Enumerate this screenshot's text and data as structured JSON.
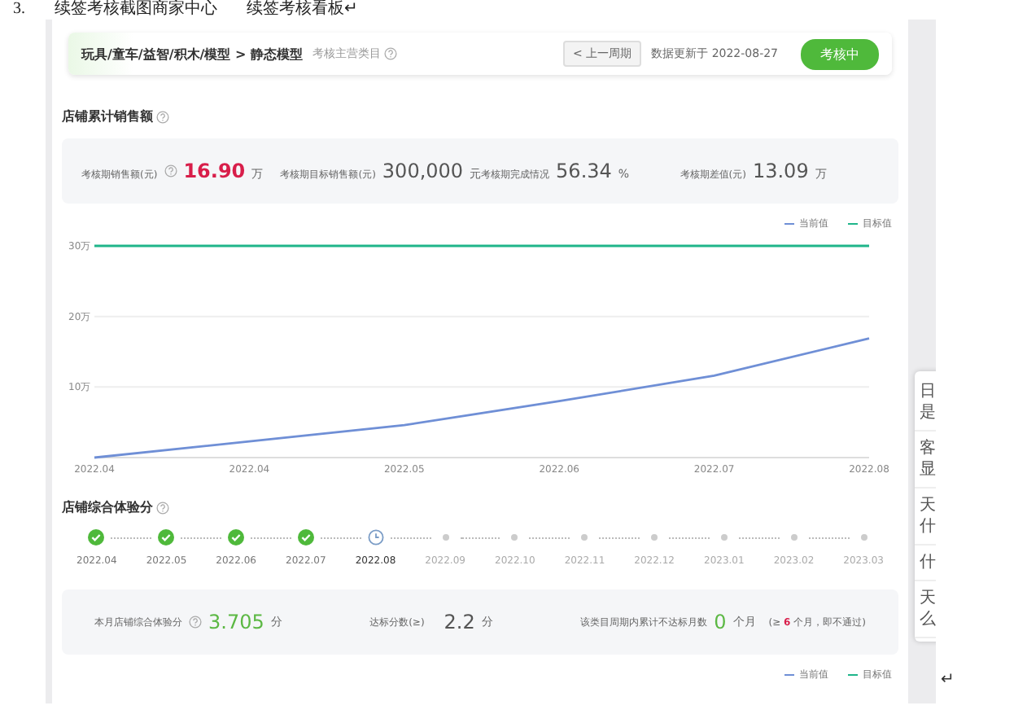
{
  "document": {
    "heading": [
      "3.",
      "续签考核截图商家中心",
      "续签考核看板↵"
    ],
    "end_mark": "↵"
  },
  "header": {
    "category_path": "玩具/童车/益智/积木/模型 > 静态模型",
    "category_hint": "考核主营类目",
    "prev_button": "< 上一周期",
    "updated": "数据更新于 2022-08-27",
    "status": "考核中"
  },
  "sales": {
    "title": "店铺累计销售额",
    "stats": [
      {
        "label": "考核期销售额(元)",
        "help": true,
        "value": "16.90",
        "unit": "万",
        "highlighted": true
      },
      {
        "label": "考核期目标销售额(元)",
        "help": false,
        "value": "300,000",
        "unit": "元",
        "highlighted": false
      },
      {
        "label": "考核期完成情况",
        "help": false,
        "value": "56.34",
        "unit": "%",
        "highlighted": false
      },
      {
        "label": "考核期差值(元)",
        "help": false,
        "value": "13.09",
        "unit": "万",
        "highlighted": false
      }
    ],
    "chart_data": {
      "type": "line",
      "categories": [
        "2022.04",
        "2022.04",
        "2022.05",
        "2022.06",
        "2022.07",
        "2022.08"
      ],
      "series": [
        {
          "name": "当前值",
          "color": "#6f8fd6",
          "values": [
            0,
            2.3,
            4.6,
            8.0,
            11.6,
            16.9
          ]
        },
        {
          "name": "目标值",
          "color": "#1fb58a",
          "values": [
            30,
            30,
            30,
            30,
            30,
            30
          ]
        }
      ],
      "ylim": [
        0,
        30
      ],
      "yticks": [
        {
          "value": 10,
          "label": "10万"
        },
        {
          "value": 20,
          "label": "20万"
        },
        {
          "value": 30,
          "label": "30万"
        }
      ]
    }
  },
  "experience": {
    "title": "店铺综合体验分",
    "months": [
      {
        "label": "2022.04",
        "kind": "done"
      },
      {
        "label": "2022.05",
        "kind": "done"
      },
      {
        "label": "2022.06",
        "kind": "done"
      },
      {
        "label": "2022.07",
        "kind": "done"
      },
      {
        "label": "2022.08",
        "kind": "current"
      },
      {
        "label": "2022.09",
        "kind": "pending"
      },
      {
        "label": "2022.10",
        "kind": "pending"
      },
      {
        "label": "2022.11",
        "kind": "pending"
      },
      {
        "label": "2022.12",
        "kind": "pending"
      },
      {
        "label": "2023.01",
        "kind": "pending"
      },
      {
        "label": "2023.02",
        "kind": "pending"
      },
      {
        "label": "2023.03",
        "kind": "pending"
      }
    ],
    "score": {
      "label": "本月店铺综合体验分",
      "value": "3.705",
      "unit": "分"
    },
    "target": {
      "label": "达标分数(≥)",
      "value": "2.2",
      "unit": "分"
    },
    "failed": {
      "label": "该类目周期内累计不达标月数",
      "value": "0",
      "unit": "个月",
      "note_before": "(≥",
      "note_count": "6",
      "note_after": "个月，即不通过)"
    },
    "legend": [
      {
        "name": "当前值",
        "color": "#6f8fd6"
      },
      {
        "name": "目标值",
        "color": "#1fb58a"
      }
    ]
  },
  "side_popup": {
    "items": [
      [
        "日",
        "是"
      ],
      [
        "客",
        "显"
      ],
      [
        "天",
        "什"
      ],
      [
        "什"
      ],
      [
        "天",
        "么"
      ]
    ]
  }
}
